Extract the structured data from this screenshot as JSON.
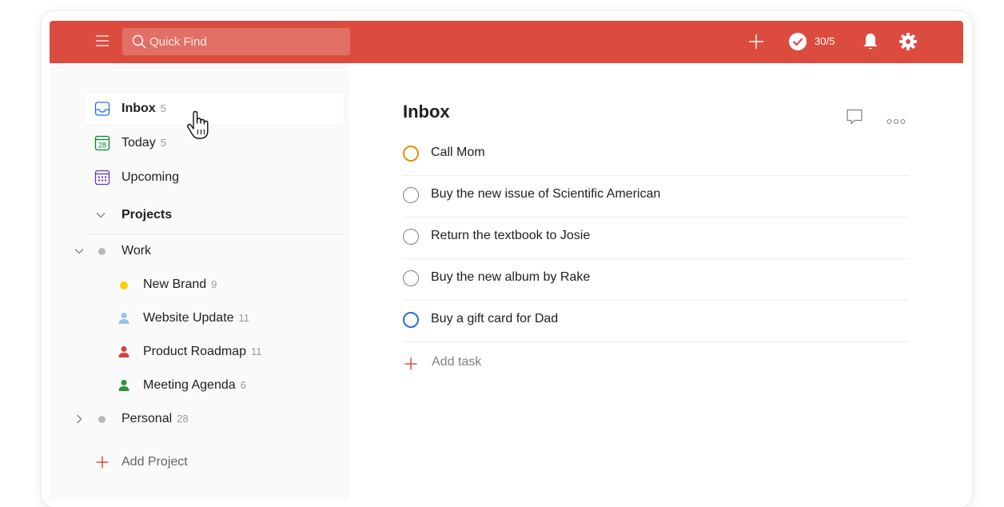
{
  "topbar": {
    "search_placeholder": "Quick Find",
    "karma_text": "30/5",
    "accent_color": "#db4c3f"
  },
  "sidebar": {
    "views": [
      {
        "label": "Inbox",
        "count": "5",
        "icon": "inbox-icon"
      },
      {
        "label": "Today",
        "count": "5",
        "icon": "calendar-today-icon",
        "icon_text": "28"
      },
      {
        "label": "Upcoming",
        "count": "",
        "icon": "calendar-upcoming-icon"
      }
    ],
    "projects_label": "Projects",
    "projects": [
      {
        "label": "Work",
        "count": "",
        "color": "#b8b8b8",
        "icon": "project-dot"
      },
      {
        "label": "New Brand",
        "count": "9",
        "color": "#fad000",
        "icon": "project-dot"
      },
      {
        "label": "Website Update",
        "count": "11",
        "color": "#96c3eb",
        "icon": "person-icon"
      },
      {
        "label": "Product Roadmap",
        "count": "11",
        "color": "#db4035",
        "icon": "person-icon"
      },
      {
        "label": "Meeting Agenda",
        "count": "6",
        "color": "#299438",
        "icon": "person-icon"
      },
      {
        "label": "Personal",
        "count": "28",
        "color": "#b8b8b8",
        "icon": "project-dot"
      }
    ],
    "add_project_label": "Add Project"
  },
  "main": {
    "title": "Inbox",
    "tasks": [
      {
        "text": "Call Mom",
        "priority_color": "#eb8909"
      },
      {
        "text": "Buy the new issue of Scientific American",
        "priority_color": "#808080"
      },
      {
        "text": "Return the textbook to Josie",
        "priority_color": "#808080"
      },
      {
        "text": "Buy the new album by Rake",
        "priority_color": "#808080"
      },
      {
        "text": "Buy a gift card for Dad",
        "priority_color": "#246fe0"
      }
    ],
    "add_task_label": "Add task"
  }
}
